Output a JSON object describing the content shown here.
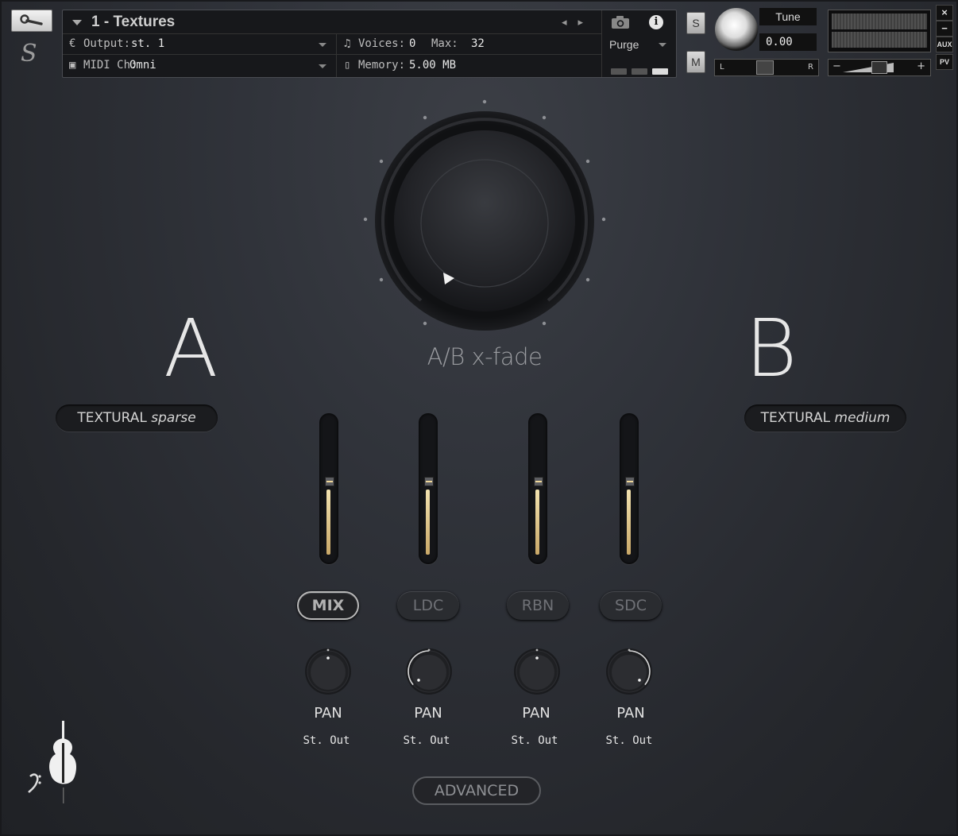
{
  "header": {
    "instrument_title": "1 - Textures",
    "output_label": "Output:",
    "output_value": "st. 1",
    "midi_label": "MIDI Ch:",
    "midi_value": "Omni",
    "voices_label": "Voices:",
    "voices_value": "0",
    "max_label": "Max:",
    "max_value": "32",
    "memory_label": "Memory:",
    "memory_value": "5.00 MB",
    "purge_label": "Purge",
    "solo_label": "S",
    "mute_label": "M",
    "tune_label": "Tune",
    "tune_value": "0.00",
    "pan_left": "L",
    "pan_right": "R",
    "vol_minus": "−",
    "vol_plus": "+",
    "side_close": "×",
    "side_minimize": "−",
    "side_aux": "AUX",
    "side_pv": "PV"
  },
  "logo_text": "S",
  "xfade": {
    "label": "A/B x-fade"
  },
  "side_a": {
    "letter": "A",
    "preset_main": "TEXTURAL ",
    "preset_style": "sparse"
  },
  "side_b": {
    "letter": "B",
    "preset_main": "TEXTURAL ",
    "preset_style": "medium"
  },
  "channels": [
    {
      "name": "MIX",
      "active": true,
      "level": 0.58,
      "pan_label": "PAN",
      "output": "St. Out"
    },
    {
      "name": "LDC",
      "active": false,
      "level": 0.58,
      "pan_label": "PAN",
      "output": "St. Out"
    },
    {
      "name": "RBN",
      "active": false,
      "level": 0.58,
      "pan_label": "PAN",
      "output": "St. Out"
    },
    {
      "name": "SDC",
      "active": false,
      "level": 0.58,
      "pan_label": "PAN",
      "output": "St. Out"
    }
  ],
  "advanced_label": "ADVANCED",
  "colors": {
    "accent": "#e8d29a",
    "background": "#2d2f35"
  }
}
